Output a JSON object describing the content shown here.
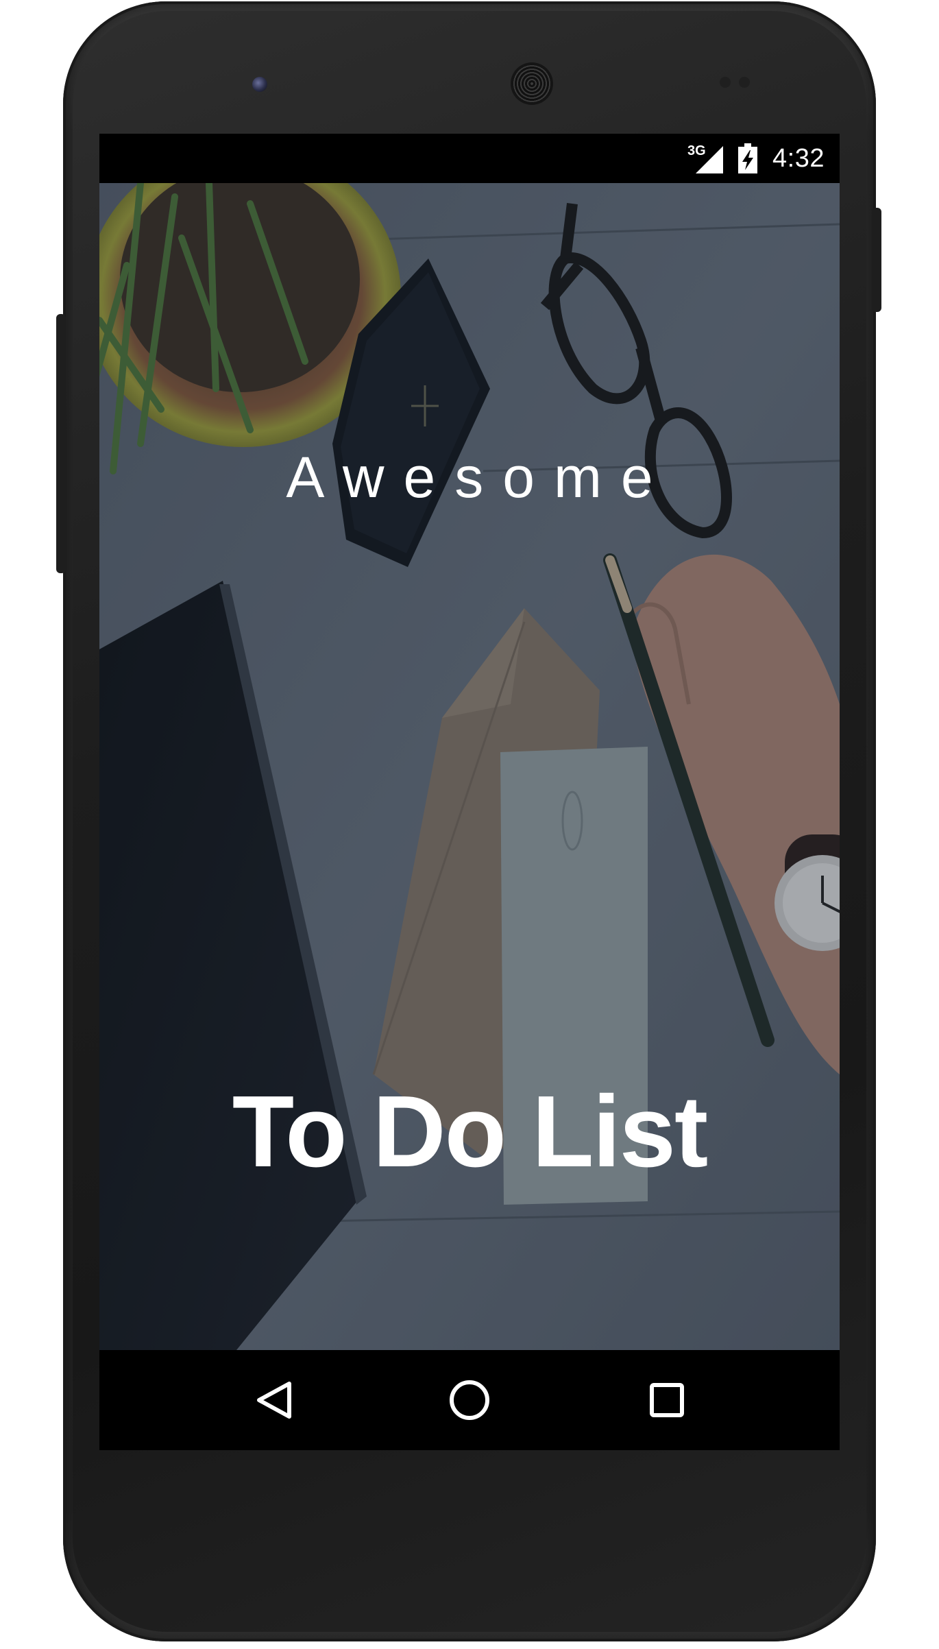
{
  "status_bar": {
    "network_type": "3G",
    "time": "4:32",
    "icons": [
      "signal-icon",
      "battery-charging-icon"
    ]
  },
  "splash": {
    "subtitle": "Awesome",
    "title": "To Do List",
    "background": "desk-photo-plant-glasses-tablet-envelope-hand-watch"
  },
  "nav_bar": {
    "icons": [
      "back-icon",
      "home-icon",
      "recents-icon"
    ]
  },
  "colors": {
    "text": "#ffffff",
    "bars": "#000000",
    "device": "#262626"
  }
}
